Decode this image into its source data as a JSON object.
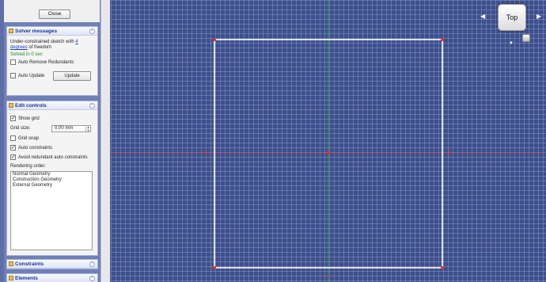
{
  "panel": {
    "close_label": "Close",
    "solver": {
      "title": "Solver messages",
      "status_prefix": "Under-constrained sketch with",
      "dof_link_line1": "4",
      "dof_link_line2": "degrees",
      "status_suffix": "of freedom",
      "solved": "Solved in 0 sec",
      "auto_remove_label": "Auto Remove Redundants",
      "auto_update_label": "Auto Update",
      "update_label": "Update"
    },
    "edit": {
      "title": "Edit controls",
      "show_grid_label": "Show grid",
      "grid_size_label": "Grid size:",
      "grid_size_value": "0.00 mm",
      "grid_snap_label": "Grid snap",
      "auto_constraints_label": "Auto constraints",
      "avoid_redundant_label": "Avoid redundant auto constraints",
      "rendering_order_label": "Rendering order:",
      "rendering_order_items": [
        "Normal Geometry",
        "Construction Geometry",
        "External Geometry"
      ]
    },
    "constraints_title": "Constraints",
    "elements_title": "Elements"
  },
  "viewport": {
    "navcube_face": "Top",
    "colors": {
      "x_axis": "#d43a3a",
      "y_axis": "#2fa84a",
      "sketch": "#ffffff",
      "vertex": "#e03030"
    }
  }
}
